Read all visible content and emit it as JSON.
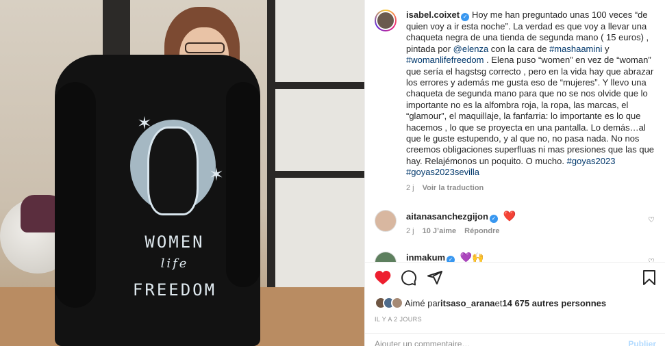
{
  "post": {
    "author": "isabel.coixet",
    "caption_parts": [
      {
        "t": "Hoy me han preguntado unas 100 veces “de quien voy a ir esta noche”. La verdad es que voy a llevar una chaqueta negra de una tienda de segunda mano ( 15 euros) , pintada por ",
        "link": false
      },
      {
        "t": "@elenza",
        "link": true
      },
      {
        "t": " con la cara de ",
        "link": false
      },
      {
        "t": "#mashaamini",
        "link": true
      },
      {
        "t": " y ",
        "link": false
      },
      {
        "t": "#womanlifefreedom",
        "link": true
      },
      {
        "t": " . Elena puso “women” en vez de “woman” que sería el hagstsg correcto , pero en la vida hay que abrazar los errores y además me gusta eso de “mujeres”. Y llevo una chaqueta de segunda mano para que no se nos olvide que lo importante no es la alfombra roja, la ropa, las marcas, el “glamour”, el maquillaje, la fanfarria: lo importante es lo que hacemos , lo que se proyecta en una pantalla. Lo demás…al que le guste estupendo, y al que no, no pasa nada. No nos creemos obligaciones superfluas ni mas presiones que las que hay. Relajémonos un poquito. O mucho. ",
        "link": false
      },
      {
        "t": "#goyas2023",
        "link": true
      },
      {
        "t": " ",
        "link": false
      },
      {
        "t": "#goyas2023sevilla",
        "link": true
      }
    ],
    "time": "2 j",
    "translate": "Voir la traduction"
  },
  "comments": [
    {
      "user": "aitanasanchezgijon",
      "emoji": "❤️",
      "time": "2 j",
      "likes": "10 J’aime",
      "reply": "Répondre"
    },
    {
      "user": "inmakum",
      "emoji": "💜🙌"
    }
  ],
  "likes_text": {
    "prefix": "Aimé par ",
    "user": "itsaso_arana",
    "middle": " et ",
    "count": "14 675 autres personnes"
  },
  "posted_ago": "IL Y A 2 JOURS",
  "add_comment": {
    "placeholder": "Ajouter un commentaire…",
    "publish": "Publier"
  },
  "jacket": {
    "line1": "WOMEN",
    "line2": "life",
    "line3": "FREEDOM"
  },
  "colors": {
    "link": "#00376b",
    "like_red": "#ed1f2f",
    "verified": "#3897f0"
  },
  "icons": [
    "heart-icon",
    "comment-icon",
    "share-icon",
    "bookmark-icon",
    "verified-icon"
  ]
}
